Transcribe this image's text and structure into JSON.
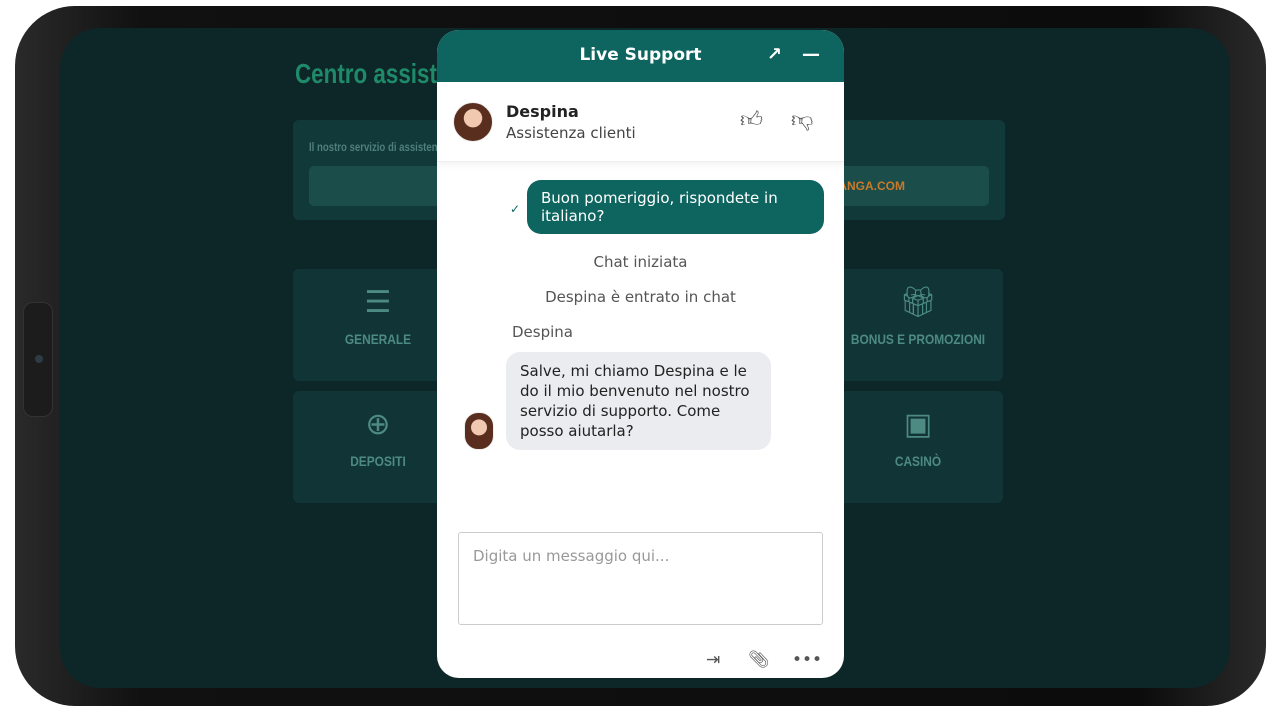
{
  "background": {
    "title": "Centro assistenza",
    "service_text": "Il nostro servizio di assistenza",
    "link": "...ANGA.COM",
    "categories": [
      {
        "label": "GENERALE",
        "icon": "list-icon"
      },
      {
        "label": "BONUS E PROMOZIONI",
        "icon": "gift-icon"
      },
      {
        "label": "DEPOSITI",
        "icon": "coins-plus-icon"
      },
      {
        "label": "CASINÒ",
        "icon": "slot-machine-icon"
      }
    ]
  },
  "chat": {
    "title": "Live Support",
    "colors": {
      "brand": "#0e6560"
    },
    "agent": {
      "name": "Despina",
      "role": "Assistenza clienti"
    },
    "messages": {
      "outgoing": "Buon pomeriggio, rispondete in italiano?",
      "status_chat_started": "Chat iniziata",
      "status_agent_joined": "Despina è entrato in chat",
      "sender": "Despina",
      "incoming": "Salve, mi chiamo Despina e le do il mio benvenuto nel nostro servizio di supporto. Come posso aiutarla?"
    },
    "input": {
      "placeholder": "Digita un messaggio qui...",
      "value": ""
    }
  }
}
